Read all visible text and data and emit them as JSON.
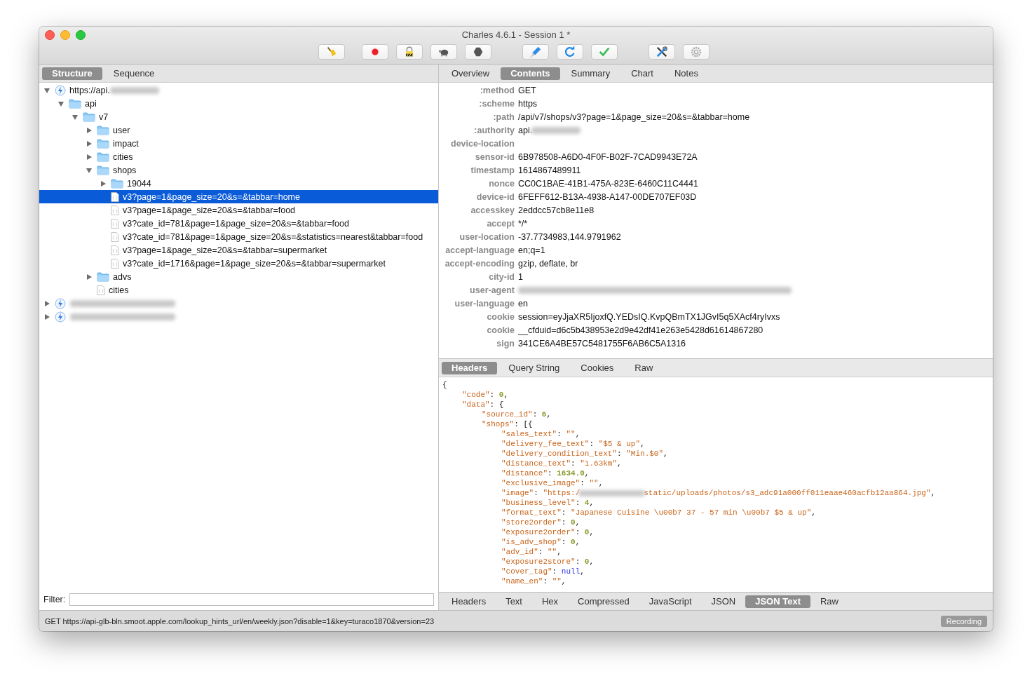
{
  "window": {
    "title": "Charles 4.6.1 - Session 1 *"
  },
  "toolbar": [
    {
      "kind": "broom"
    },
    {
      "kind": "record"
    },
    {
      "kind": "lock"
    },
    {
      "kind": "turtle"
    },
    {
      "kind": "stop"
    },
    {
      "kind": "pen"
    },
    {
      "kind": "refresh"
    },
    {
      "kind": "check"
    },
    {
      "kind": "tools"
    },
    {
      "kind": "gear"
    }
  ],
  "left_tabs": [
    {
      "label": "Structure",
      "selected": true
    },
    {
      "label": "Sequence",
      "selected": false
    }
  ],
  "tree": [
    {
      "kind": "host",
      "label": "https://api.",
      "redacted": true,
      "expanded": true,
      "selected": false,
      "children": [
        {
          "kind": "folder",
          "label": "api",
          "expanded": true,
          "selected": false,
          "children": [
            {
              "kind": "folder",
              "label": "v7",
              "expanded": true,
              "selected": false,
              "children": [
                {
                  "kind": "folder",
                  "label": "user",
                  "expanded": false,
                  "selected": false
                },
                {
                  "kind": "folder",
                  "label": "impact",
                  "expanded": false,
                  "selected": false
                },
                {
                  "kind": "folder",
                  "label": "cities",
                  "expanded": false,
                  "selected": false
                },
                {
                  "kind": "folder",
                  "label": "shops",
                  "expanded": true,
                  "selected": false,
                  "children": [
                    {
                      "kind": "folder",
                      "label": "19044",
                      "expanded": false,
                      "selected": false
                    },
                    {
                      "kind": "file",
                      "label": "v3?page=1&page_size=20&s=&tabbar=home",
                      "selected": true
                    },
                    {
                      "kind": "file",
                      "label": "v3?page=1&page_size=20&s=&tabbar=food",
                      "selected": false
                    },
                    {
                      "kind": "file",
                      "label": "v3?cate_id=781&page=1&page_size=20&s=&tabbar=food",
                      "selected": false
                    },
                    {
                      "kind": "file",
                      "label": "v3?cate_id=781&page=1&page_size=20&s=&statistics=nearest&tabbar=food",
                      "selected": false
                    },
                    {
                      "kind": "file",
                      "label": "v3?page=1&page_size=20&s=&tabbar=supermarket",
                      "selected": false
                    },
                    {
                      "kind": "file",
                      "label": "v3?cate_id=1716&page=1&page_size=20&s=&tabbar=supermarket",
                      "selected": false
                    }
                  ]
                },
                {
                  "kind": "folder",
                  "label": "advs",
                  "expanded": false,
                  "selected": false
                },
                {
                  "kind": "file",
                  "label": "cities",
                  "selected": false
                }
              ]
            }
          ]
        }
      ]
    },
    {
      "kind": "host",
      "redacted": true,
      "expanded": false,
      "selected": false
    },
    {
      "kind": "host",
      "redacted": true,
      "expanded": false,
      "selected": false
    }
  ],
  "filter": {
    "label": "Filter:"
  },
  "top_tabs": [
    {
      "label": "Overview",
      "selected": false
    },
    {
      "label": "Contents",
      "selected": true
    },
    {
      "label": "Summary",
      "selected": false
    },
    {
      "label": "Chart",
      "selected": false
    },
    {
      "label": "Notes",
      "selected": false
    }
  ],
  "headers": [
    {
      "name": ":method",
      "value": "GET"
    },
    {
      "name": ":scheme",
      "value": "https"
    },
    {
      "name": ":path",
      "value": "/api/v7/shops/v3?page=1&page_size=20&s=&tabbar=home"
    },
    {
      "name": ":authority",
      "value": "api.",
      "redacted": true
    },
    {
      "name": "device-location"
    },
    {
      "name": "sensor-id",
      "value": "6B978508-A6D0-4F0F-B02F-7CAD9943E72A"
    },
    {
      "name": "timestamp",
      "value": "1614867489911"
    },
    {
      "name": "nonce",
      "value": "CC0C1BAE-41B1-475A-823E-6460C11C4441"
    },
    {
      "name": "device-id",
      "value": "6FEFF612-B13A-4938-A147-00DE707EF03D"
    },
    {
      "name": "accesskey",
      "value": "2eddcc57cb8e11e8"
    },
    {
      "name": "accept",
      "value": "*/*"
    },
    {
      "name": "user-location",
      "value": "-37.7734983,144.9791962"
    },
    {
      "name": "accept-language",
      "value": "en;q=1"
    },
    {
      "name": "accept-encoding",
      "value": "gzip, deflate, br"
    },
    {
      "name": "city-id",
      "value": "1"
    },
    {
      "name": "user-agent",
      "redacted": true
    },
    {
      "name": "user-language",
      "value": "en"
    },
    {
      "name": "cookie",
      "value": "session=eyJjaXR5IjoxfQ.YEDsIQ.KvpQBmTX1JGvI5q5XAcf4ryIvxs"
    },
    {
      "name": "cookie",
      "value": "__cfduid=d6c5b438953e2d9e42df41e263e5428d61614867280"
    },
    {
      "name": "sign",
      "value": "341CE6A4BE57C5481755F6AB6C5A1316"
    }
  ],
  "mid_tabs": [
    {
      "label": "Headers",
      "selected": true
    },
    {
      "label": "Query String",
      "selected": false
    },
    {
      "label": "Cookies",
      "selected": false
    },
    {
      "label": "Raw",
      "selected": false
    }
  ],
  "json_lines": [
    {
      "tokens": [
        {
          "kind": "plain",
          "text": "{"
        }
      ],
      "children": [
        {
          "tokens": [
            {
              "kind": "key",
              "text": "\"code\""
            },
            {
              "kind": "plain",
              "text": ": "
            },
            {
              "kind": "number",
              "text": "0"
            },
            {
              "kind": "plain",
              "text": ","
            }
          ]
        },
        {
          "tokens": [
            {
              "kind": "key",
              "text": "\"data\""
            },
            {
              "kind": "plain",
              "text": ": {"
            }
          ],
          "children": [
            {
              "tokens": [
                {
                  "kind": "key",
                  "text": "\"source_id\""
                },
                {
                  "kind": "plain",
                  "text": ": "
                },
                {
                  "kind": "number",
                  "text": "6"
                },
                {
                  "kind": "plain",
                  "text": ","
                }
              ]
            },
            {
              "tokens": [
                {
                  "kind": "key",
                  "text": "\"shops\""
                },
                {
                  "kind": "plain",
                  "text": ": [{"
                }
              ],
              "children": [
                {
                  "tokens": [
                    {
                      "kind": "key",
                      "text": "\"sales_text\""
                    },
                    {
                      "kind": "plain",
                      "text": ": "
                    },
                    {
                      "kind": "string",
                      "text": "\"\""
                    },
                    {
                      "kind": "plain",
                      "text": ","
                    }
                  ]
                },
                {
                  "tokens": [
                    {
                      "kind": "key",
                      "text": "\"delivery_fee_text\""
                    },
                    {
                      "kind": "plain",
                      "text": ": "
                    },
                    {
                      "kind": "string",
                      "text": "\"$5 & up\""
                    },
                    {
                      "kind": "plain",
                      "text": ","
                    }
                  ]
                },
                {
                  "tokens": [
                    {
                      "kind": "key",
                      "text": "\"delivery_condition_text\""
                    },
                    {
                      "kind": "plain",
                      "text": ": "
                    },
                    {
                      "kind": "string",
                      "text": "\"Min.$0\""
                    },
                    {
                      "kind": "plain",
                      "text": ","
                    }
                  ]
                },
                {
                  "tokens": [
                    {
                      "kind": "key",
                      "text": "\"distance_text\""
                    },
                    {
                      "kind": "plain",
                      "text": ": "
                    },
                    {
                      "kind": "string",
                      "text": "\"1.63km\""
                    },
                    {
                      "kind": "plain",
                      "text": ","
                    }
                  ]
                },
                {
                  "tokens": [
                    {
                      "kind": "key",
                      "text": "\"distance\""
                    },
                    {
                      "kind": "plain",
                      "text": ": "
                    },
                    {
                      "kind": "number",
                      "text": "1634.0"
                    },
                    {
                      "kind": "plain",
                      "text": ","
                    }
                  ]
                },
                {
                  "tokens": [
                    {
                      "kind": "key",
                      "text": "\"exclusive_image\""
                    },
                    {
                      "kind": "plain",
                      "text": ": "
                    },
                    {
                      "kind": "string",
                      "text": "\"\""
                    },
                    {
                      "kind": "plain",
                      "text": ","
                    }
                  ]
                },
                {
                  "tokens": [
                    {
                      "kind": "key",
                      "text": "\"image\""
                    },
                    {
                      "kind": "plain",
                      "text": ": "
                    },
                    {
                      "kind": "string",
                      "text": "\"https:/"
                    },
                    {
                      "kind": "redacted"
                    },
                    {
                      "kind": "string",
                      "text": "static/uploads/photos/s3_adc91a000ff011eaae460acfb12aa864.jpg\""
                    },
                    {
                      "kind": "plain",
                      "text": ","
                    }
                  ]
                },
                {
                  "tokens": [
                    {
                      "kind": "key",
                      "text": "\"business_level\""
                    },
                    {
                      "kind": "plain",
                      "text": ": "
                    },
                    {
                      "kind": "number",
                      "text": "4"
                    },
                    {
                      "kind": "plain",
                      "text": ","
                    }
                  ]
                },
                {
                  "tokens": [
                    {
                      "kind": "key",
                      "text": "\"format_text\""
                    },
                    {
                      "kind": "plain",
                      "text": ": "
                    },
                    {
                      "kind": "string",
                      "text": "\"Japanese Cuisine \\u00b7 37 - 57 min \\u00b7 $5 & up\""
                    },
                    {
                      "kind": "plain",
                      "text": ","
                    }
                  ]
                },
                {
                  "tokens": [
                    {
                      "kind": "key",
                      "text": "\"store2order\""
                    },
                    {
                      "kind": "plain",
                      "text": ": "
                    },
                    {
                      "kind": "number",
                      "text": "0"
                    },
                    {
                      "kind": "plain",
                      "text": ","
                    }
                  ]
                },
                {
                  "tokens": [
                    {
                      "kind": "key",
                      "text": "\"exposure2order\""
                    },
                    {
                      "kind": "plain",
                      "text": ": "
                    },
                    {
                      "kind": "number",
                      "text": "0"
                    },
                    {
                      "kind": "plain",
                      "text": ","
                    }
                  ]
                },
                {
                  "tokens": [
                    {
                      "kind": "key",
                      "text": "\"is_adv_shop\""
                    },
                    {
                      "kind": "plain",
                      "text": ": "
                    },
                    {
                      "kind": "number",
                      "text": "0"
                    },
                    {
                      "kind": "plain",
                      "text": ","
                    }
                  ]
                },
                {
                  "tokens": [
                    {
                      "kind": "key",
                      "text": "\"adv_id\""
                    },
                    {
                      "kind": "plain",
                      "text": ": "
                    },
                    {
                      "kind": "string",
                      "text": "\"\""
                    },
                    {
                      "kind": "plain",
                      "text": ","
                    }
                  ]
                },
                {
                  "tokens": [
                    {
                      "kind": "key",
                      "text": "\"exposure2store\""
                    },
                    {
                      "kind": "plain",
                      "text": ": "
                    },
                    {
                      "kind": "number",
                      "text": "0"
                    },
                    {
                      "kind": "plain",
                      "text": ","
                    }
                  ]
                },
                {
                  "tokens": [
                    {
                      "kind": "key",
                      "text": "\"cover_tag\""
                    },
                    {
                      "kind": "plain",
                      "text": ": "
                    },
                    {
                      "kind": "null",
                      "text": "null"
                    },
                    {
                      "kind": "plain",
                      "text": ","
                    }
                  ]
                },
                {
                  "tokens": [
                    {
                      "kind": "key",
                      "text": "\"name_en\""
                    },
                    {
                      "kind": "plain",
                      "text": ": "
                    },
                    {
                      "kind": "string",
                      "text": "\"\""
                    },
                    {
                      "kind": "plain",
                      "text": ","
                    }
                  ]
                }
              ]
            }
          ]
        }
      ]
    }
  ],
  "bottom_tabs": [
    {
      "label": "Headers",
      "selected": false
    },
    {
      "label": "Text",
      "selected": false
    },
    {
      "label": "Hex",
      "selected": false
    },
    {
      "label": "Compressed",
      "selected": false
    },
    {
      "label": "JavaScript",
      "selected": false
    },
    {
      "label": "JSON",
      "selected": false
    },
    {
      "label": "JSON Text",
      "selected": true
    },
    {
      "label": "Raw",
      "selected": false
    }
  ],
  "status_bar": {
    "text": "GET https://api-glb-bln.smoot.apple.com/lookup_hints_url/en/weekly.json?disable=1&key=turaco1870&version=23",
    "badge": "Recording"
  }
}
